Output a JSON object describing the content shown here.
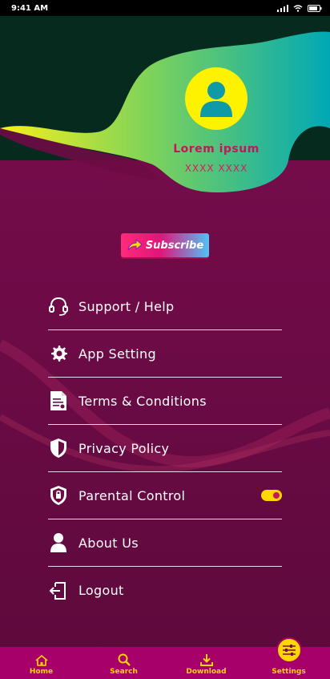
{
  "status_bar": {
    "time": "9:41 AM"
  },
  "profile": {
    "name": "Lorem ipsum",
    "subtitle": "XXXX XXXX"
  },
  "subscribe": {
    "label": "Subscribe"
  },
  "menu": {
    "items": [
      {
        "label": "Support / Help",
        "icon": "headset-icon"
      },
      {
        "label": "App Setting",
        "icon": "gear-icon"
      },
      {
        "label": "Terms & Conditions",
        "icon": "document-icon"
      },
      {
        "label": "Privacy Policy",
        "icon": "shield-icon"
      },
      {
        "label": "Parental Control",
        "icon": "lock-shield-icon",
        "toggle_on": true
      },
      {
        "label": "About Us",
        "icon": "person-icon"
      },
      {
        "label": "Logout",
        "icon": "logout-icon"
      }
    ]
  },
  "bottom_nav": {
    "items": [
      {
        "label": "Home",
        "icon": "home-icon"
      },
      {
        "label": "Search",
        "icon": "search-icon"
      },
      {
        "label": "Download",
        "icon": "download-icon"
      },
      {
        "label": "Settings",
        "icon": "sliders-icon",
        "active": true
      }
    ]
  },
  "colors": {
    "background": "#6e0b45",
    "accent": "#ffd600",
    "nav": "#a8006a",
    "header_dark": "#062a1e"
  }
}
